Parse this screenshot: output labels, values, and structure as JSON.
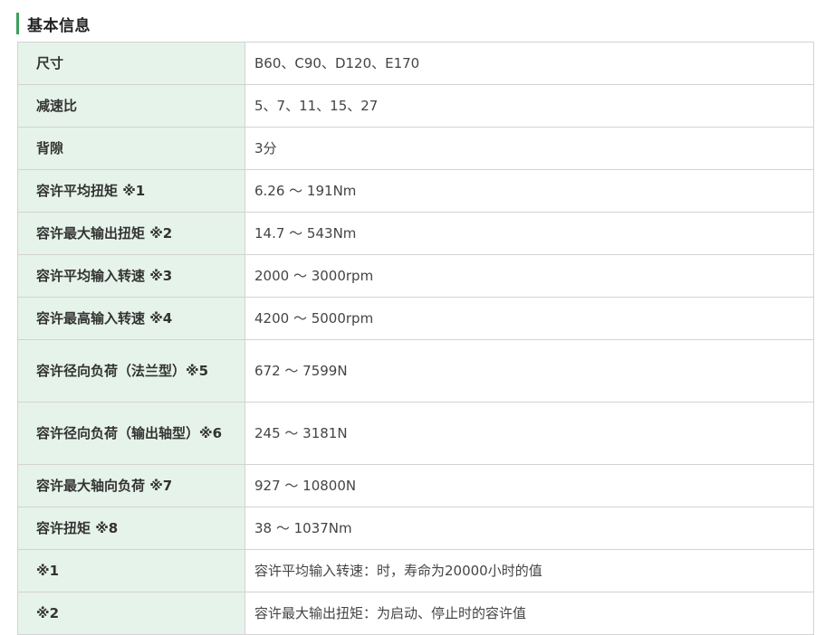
{
  "section": {
    "title": "基本信息"
  },
  "rows": [
    {
      "key": "尺寸",
      "value": "B60、C90、D120、E170"
    },
    {
      "key": "减速比",
      "value": "5、7、11、15、27"
    },
    {
      "key": "背隙",
      "value": "3分"
    },
    {
      "key": "容许平均扭矩 ※1",
      "value": "6.26 ～ 191Nm"
    },
    {
      "key": "容许最大输出扭矩 ※2",
      "value": "14.7 ～ 543Nm"
    },
    {
      "key": "容许平均输入转速 ※3",
      "value": "2000 ～ 3000rpm"
    },
    {
      "key": "容许最高输入转速 ※4",
      "value": "4200 ～ 5000rpm"
    },
    {
      "key": "容许径向负荷（法兰型）※5",
      "value": "672 ～ 7599N"
    },
    {
      "key": "容许径向负荷（输出轴型）※6",
      "value": "245 ～ 3181N"
    },
    {
      "key": "容许最大轴向负荷 ※7",
      "value": "927 ～ 10800N"
    },
    {
      "key": "容许扭矩 ※8",
      "value": "38 ～ 1037Nm"
    },
    {
      "key": "※1",
      "value": "容许平均输入转速：时，寿命为20000小时的值"
    },
    {
      "key": "※2",
      "value": "容许最大输出扭矩：为启动、停止时的容许值"
    }
  ],
  "colors": {
    "accent": "#3aa05a",
    "key_bg": "#e6f3ea",
    "border": "#d3d3d3"
  }
}
